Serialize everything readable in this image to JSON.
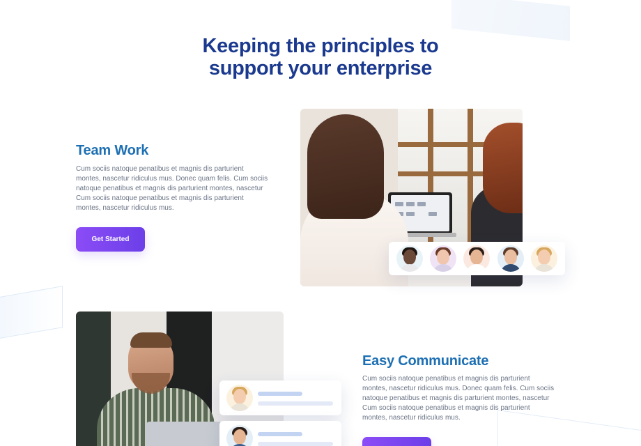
{
  "hero": {
    "title_line1": "Keeping the principles to",
    "title_line2": "support your enterprise"
  },
  "features": [
    {
      "title": "Team Work",
      "lines": [
        "Cum sociis natoque penatibus et magnis dis parturient",
        "montes, nascetur ridiculus mus. Donec quam felis. Cum sociis",
        "natoque penatibus et magnis dis parturient montes, nascetur",
        "Cum sociis natoque penatibus et magnis dis parturient",
        "montes, nascetur ridiculus mus."
      ],
      "button_label": "Get Started"
    },
    {
      "title": "Easy Communicate",
      "lines": [
        "Cum sociis natoque penatibus et magnis dis parturient",
        "montes, nascetur ridiculus mus. Donec quam felis. Cum sociis",
        "natoque penatibus et magnis dis parturient montes, nascetur",
        "Cum sociis natoque penatibus et magnis dis parturient",
        "montes, nascetur ridiculus mus."
      ],
      "button_label": ""
    }
  ],
  "colors": {
    "heading": "#1b3a8f",
    "feature_title": "#1d6fb3",
    "body_text": "#6b7486",
    "button_start": "#8b4cf6",
    "button_end": "#6c3fe8"
  },
  "avatars": [
    {
      "icon": "person-avatar-icon",
      "bg": "#e8f3f8",
      "skin": "#6b4a3a",
      "hair": "#1e1410",
      "shirt": "#e9e9ec"
    },
    {
      "icon": "person-avatar-icon",
      "bg": "#efe3f5",
      "skin": "#f0c7ae",
      "hair": "#6b3b2a",
      "shirt": "#d8d0e6"
    },
    {
      "icon": "person-avatar-icon",
      "bg": "#fbe9e1",
      "skin": "#e6b594",
      "hair": "#2b1d16",
      "shirt": "#ffffff"
    },
    {
      "icon": "person-avatar-icon",
      "bg": "#e3eef7",
      "skin": "#e9bea1",
      "hair": "#5b3a27",
      "shirt": "#2f4a6e"
    },
    {
      "icon": "person-avatar-icon",
      "bg": "#fbf1de",
      "skin": "#f4cdb0",
      "hair": "#d8a75e",
      "shirt": "#e9e3d8"
    }
  ]
}
